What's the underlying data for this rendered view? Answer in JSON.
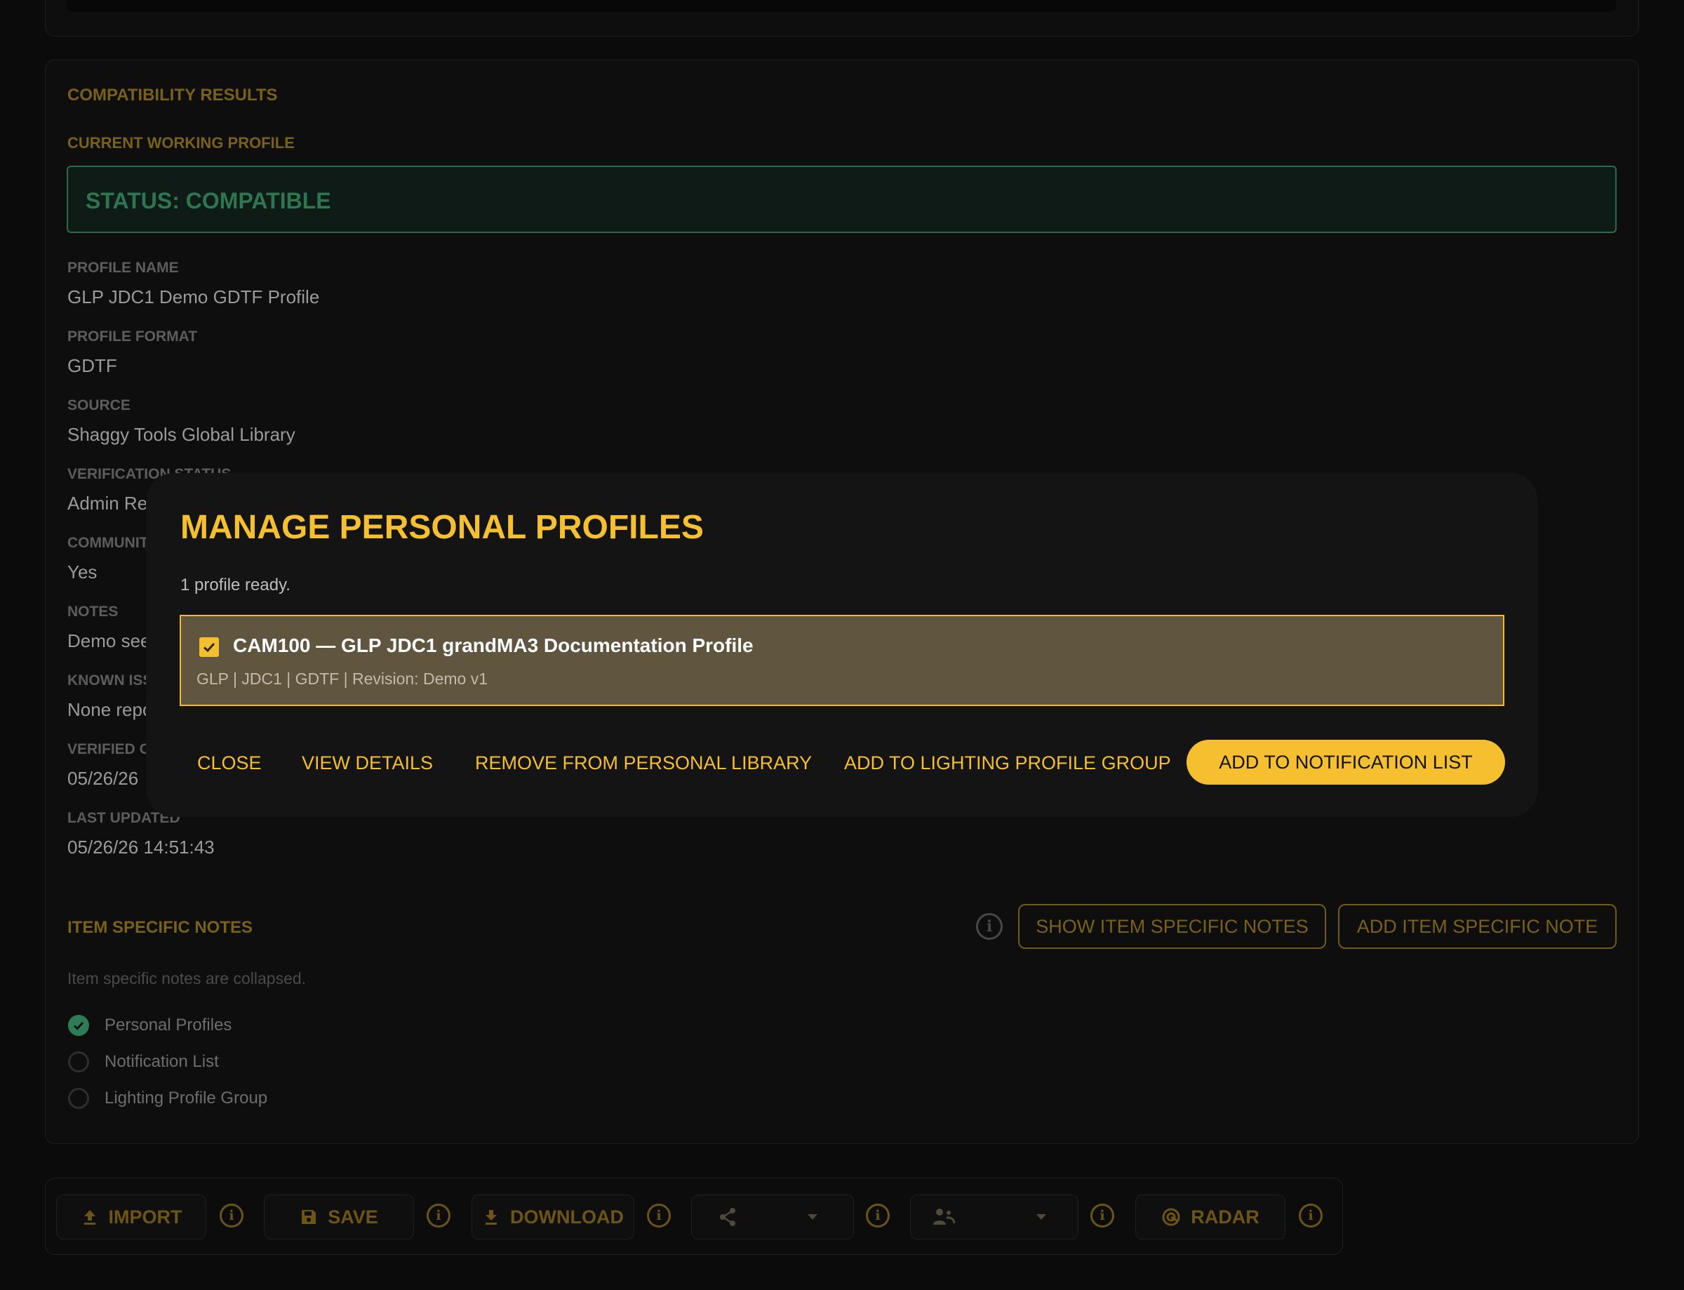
{
  "results": {
    "heading": "COMPATIBILITY RESULTS",
    "current_profile_label": "CURRENT WORKING PROFILE",
    "status": "STATUS: COMPATIBLE",
    "fields": [
      {
        "label": "PROFILE NAME",
        "value": "GLP JDC1 Demo GDTF Profile"
      },
      {
        "label": "PROFILE FORMAT",
        "value": "GDTF"
      },
      {
        "label": "SOURCE",
        "value": "Shaggy Tools Global Library"
      },
      {
        "label": "VERIFICATION STATUS",
        "value": "Admin Re"
      },
      {
        "label": "COMMUNIT",
        "value": "Yes"
      },
      {
        "label": "NOTES",
        "value": "Demo see"
      },
      {
        "label": "KNOWN ISS",
        "value": "None repo"
      },
      {
        "label": "VERIFIED O",
        "value": "05/26/26"
      },
      {
        "label": "LAST UPDATED",
        "value": "05/26/26 14:51:43"
      }
    ]
  },
  "item_notes": {
    "heading": "ITEM SPECIFIC NOTES",
    "show_button": "SHOW ITEM SPECIFIC NOTES",
    "add_button": "ADD ITEM SPECIFIC NOTE",
    "collapsed_text": "Item specific notes are collapsed.",
    "options": [
      {
        "label": "Personal Profiles",
        "checked": true
      },
      {
        "label": "Notification List",
        "checked": false
      },
      {
        "label": "Lighting Profile Group",
        "checked": false
      }
    ]
  },
  "toolbar": {
    "import": "IMPORT",
    "save": "SAVE",
    "download": "DOWNLOAD",
    "radar": "RADAR"
  },
  "modal": {
    "title": "MANAGE PERSONAL PROFILES",
    "subtitle": "1 profile ready.",
    "profile": {
      "title": "CAM100 — GLP JDC1 grandMA3 Documentation Profile",
      "meta": "GLP | JDC1 | GDTF | Revision: Demo v1",
      "checked": true
    },
    "buttons": {
      "close": "CLOSE",
      "view_details": "VIEW DETAILS",
      "remove": "REMOVE FROM PERSONAL LIBRARY",
      "add_group": "ADD TO LIGHTING PROFILE GROUP",
      "add_notification": "ADD TO NOTIFICATION LIST"
    }
  },
  "colors": {
    "accent": "#f5bf2f",
    "background": "#0b0b0b",
    "status_green": "#2e7551",
    "modal_bg": "#141414",
    "selected_item_bg": "#605640"
  }
}
